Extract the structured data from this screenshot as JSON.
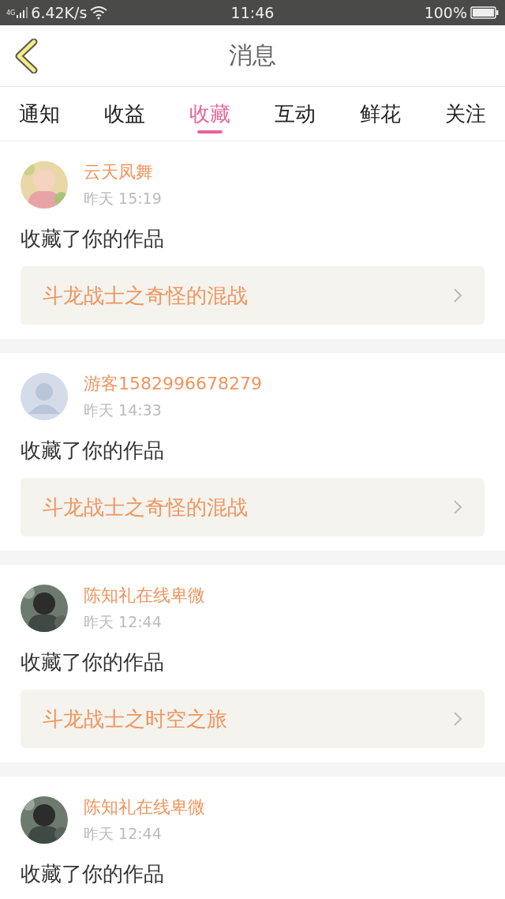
{
  "status_bar": {
    "network": "4G",
    "speed": "6.42K/s",
    "time": "11:46",
    "battery": "100%"
  },
  "header": {
    "title": "消息"
  },
  "tabs": [
    {
      "label": "通知",
      "selected": false
    },
    {
      "label": "收益",
      "selected": false
    },
    {
      "label": "收藏",
      "selected": true
    },
    {
      "label": "互动",
      "selected": false
    },
    {
      "label": "鲜花",
      "selected": false
    },
    {
      "label": "关注",
      "selected": false
    }
  ],
  "messages": [
    {
      "name": "云天凤舞",
      "time": "昨天 15:19",
      "action": "收藏了你的作品",
      "work": "斗龙战士之奇怪的混战"
    },
    {
      "avatar": {
        "kind": "default"
      },
      "name": "游客1582996678279",
      "time": "昨天 14:33",
      "action": "收藏了你的作品",
      "work": "斗龙战士之奇怪的混战"
    },
    {
      "name": "陈知礼在线卑微",
      "time": "昨天 12:44",
      "action": "收藏了你的作品",
      "work": "斗龙战士之时空之旅"
    },
    {
      "name": "陈知礼在线卑微",
      "time": "昨天 12:44",
      "action": "收藏了你的作品"
    }
  ]
}
